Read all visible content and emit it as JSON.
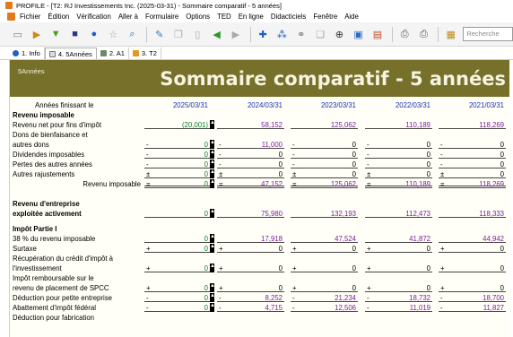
{
  "window": {
    "title": "PROFILE - [T2: RJ Investissements Inc. (2025-03-31) - Sommaire comparatif - 5 années]"
  },
  "menu": [
    "Fichier",
    "Édition",
    "Vérification",
    "Aller à",
    "Formulaire",
    "Options",
    "TED",
    "En ligne",
    "Didacticiels",
    "Fenêtre",
    "Aide"
  ],
  "search": {
    "placeholder": "Recherche"
  },
  "toolbar_icons": [
    "new-doc-icon",
    "open-icon",
    "import-icon",
    "save-icon",
    "info-icon",
    "star-icon",
    "search-doc-icon",
    "edit-icon",
    "copy-icon",
    "delete-icon",
    "back-arrow-icon",
    "forward-arrow-icon",
    "add-icon",
    "tree-icon",
    "link-icon",
    "paste-icon",
    "zoom-icon",
    "view-icon",
    "form-icon",
    "print-icon",
    "print-preview-icon",
    "calculator-icon"
  ],
  "tabs": [
    {
      "label": "1. Info"
    },
    {
      "label": "4. 5Années"
    },
    {
      "label": "2. A1"
    },
    {
      "label": "3. T2"
    }
  ],
  "form": {
    "tag": "5Années",
    "title": "Sommaire comparatif - 5 années"
  },
  "years_label": "Années finissant le",
  "years": [
    "2025/03/31",
    "2024/03/31",
    "2023/03/31",
    "2022/03/31",
    "2021/03/31"
  ],
  "sections": {
    "revenu_imposable": "Revenu imposable",
    "revenu_entreprise_1": "Revenu d'entreprise",
    "revenu_entreprise_2": "exploitée activement",
    "impot_partie1": "Impôt Partie I"
  },
  "rows": {
    "rev_net": {
      "label": "Revenu net pour fins d'impôt",
      "values": [
        "(20,001)",
        "58,152",
        "125,062",
        "110,189",
        "118,269"
      ]
    },
    "dons_1": {
      "label": "Dons de bienfaisance et"
    },
    "dons_2": {
      "label": "autres dons",
      "op": "-",
      "values": [
        "0",
        "11,000",
        "0",
        "0",
        "0"
      ]
    },
    "dividendes": {
      "label": "Dividendes imposables",
      "op": "-",
      "values": [
        "0",
        "0",
        "0",
        "0",
        "0"
      ]
    },
    "pertes": {
      "label": "Pertes des autres années",
      "op": "-",
      "values": [
        "0",
        "0",
        "0",
        "0",
        "0"
      ]
    },
    "autres": {
      "label": "Autres rajustements",
      "op": "±",
      "values": [
        "0",
        "0",
        "0",
        "0",
        "0"
      ]
    },
    "rev_imposable": {
      "label": "Revenu imposable",
      "op": "=",
      "values": [
        "0",
        "47,152",
        "125,062",
        "110,189",
        "118,269"
      ]
    },
    "rev_entreprise": {
      "values": [
        "0",
        "75,980",
        "132,193",
        "112,473",
        "118,333"
      ]
    },
    "pct38": {
      "label": "38 % du revenu imposable",
      "values": [
        "0",
        "17,918",
        "47,524",
        "41,872",
        "44,942"
      ]
    },
    "surtaxe": {
      "label": "Surtaxe",
      "op": "+",
      "values": [
        "0",
        "0",
        "0",
        "0",
        "0"
      ]
    },
    "recup_1": {
      "label": "Récupération du crédit d'impôt à"
    },
    "recup_2": {
      "label": "l'investissement",
      "op": "+",
      "values": [
        "0",
        "0",
        "0",
        "0",
        "0"
      ]
    },
    "impot_remb_1": {
      "label": "Impôt remboursable sur le"
    },
    "impot_remb_2": {
      "label": "revenu de placement de SPCC",
      "op": "+",
      "values": [
        "0",
        "0",
        "0",
        "0",
        "0"
      ]
    },
    "deduction_pe": {
      "label": "Déduction pour petite entreprise",
      "op": "-",
      "values": [
        "0",
        "8,252",
        "21,234",
        "18,732",
        "18,700"
      ]
    },
    "abattement": {
      "label": "Abattement d'impôt fédéral",
      "op": "-",
      "values": [
        "0",
        "4,715",
        "12,506",
        "11,019",
        "11,827"
      ]
    },
    "deduction_fab": {
      "label": "Déduction pour fabrication"
    }
  }
}
